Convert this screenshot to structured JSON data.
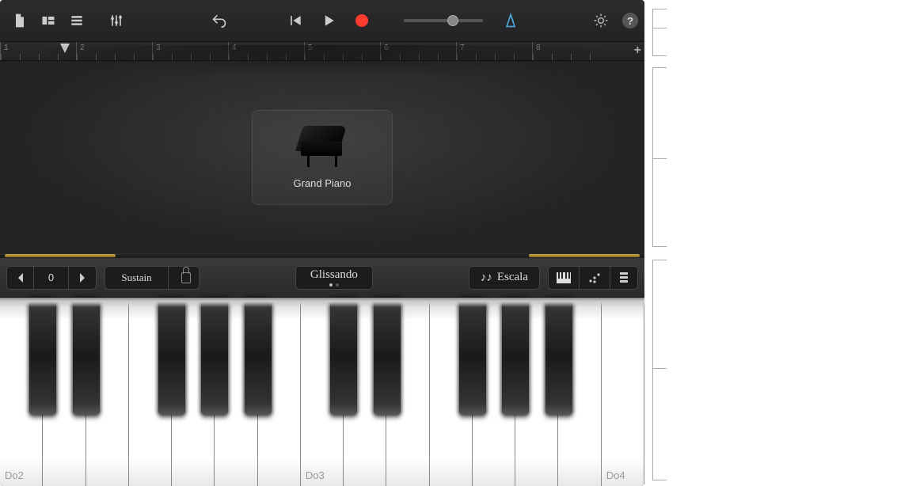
{
  "toolbar": {
    "undo_label": "Undo",
    "settings_label": "Settings",
    "help_label": "?"
  },
  "ruler": {
    "bars": [
      "1",
      "2",
      "3",
      "4",
      "5",
      "6",
      "7",
      "8"
    ]
  },
  "instrument": {
    "name": "Grand Piano"
  },
  "kb_controls": {
    "octave_value": "0",
    "sustain_label": "Sustain",
    "play_mode_label": "Glissando",
    "scale_label": "Escala"
  },
  "keyboard": {
    "white_labels": {
      "0": "Do2",
      "7": "Do3",
      "14": "Do4"
    }
  },
  "colors": {
    "record": "#ff3b30",
    "metronome": "#4da7d6",
    "gold": "#c9a94d"
  }
}
